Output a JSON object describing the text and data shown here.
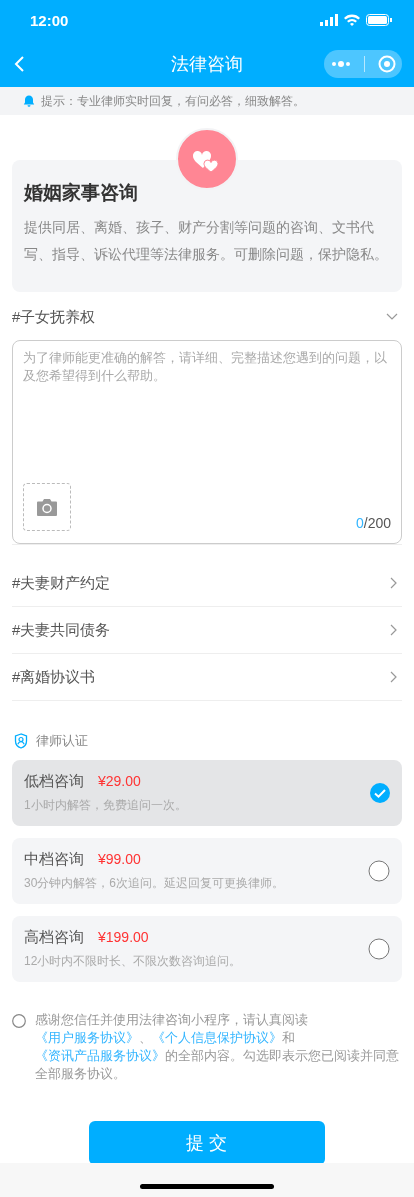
{
  "status_bar": {
    "time": "12:00"
  },
  "nav": {
    "title": "法律咨询"
  },
  "tip": {
    "text": "提示：专业律师实时回复，有问必答，细致解答。"
  },
  "category": {
    "title": "婚姻家事咨询",
    "description": "提供同居、离婚、孩子、财产分割等问题的咨询、文书代写、指导、诉讼代理等法律服务。可删除问题，保护隐私。"
  },
  "topics": [
    {
      "label": "#子女抚养权",
      "expanded": true
    },
    {
      "label": "#夫妻财产约定",
      "expanded": false
    },
    {
      "label": "#夫妻共同债务",
      "expanded": false
    },
    {
      "label": "#离婚协议书",
      "expanded": false
    }
  ],
  "question": {
    "placeholder": "为了律师能更准确的解答，请详细、完整描述您遇到的问题，以及您希望得到什么帮助。",
    "count": "0",
    "limit": "/200"
  },
  "certification": {
    "label": "律师认证"
  },
  "plans": [
    {
      "name": "低档咨询",
      "price": "¥29.00",
      "note": "1小时内解答，免费追问一次。",
      "selected": true
    },
    {
      "name": "中档咨询",
      "price": "¥99.00",
      "note": "30分钟内解答，6次追问。延迟回复可更换律师。",
      "selected": false
    },
    {
      "name": "高档咨询",
      "price": "¥199.00",
      "note": "12小时内不限时长、不限次数咨询追问。",
      "selected": false
    }
  ],
  "agreement": {
    "checked": false,
    "parts": [
      {
        "kind": "text",
        "text": "感谢您信任并使用法律咨询小程序，请认真阅读"
      },
      {
        "kind": "link",
        "text": "《用户服务协议》"
      },
      {
        "kind": "text",
        "text": "、"
      },
      {
        "kind": "link",
        "text": "《个人信息保护协议》"
      },
      {
        "kind": "text",
        "text": "和"
      },
      {
        "kind": "link",
        "text": "《资讯产品服务协议》"
      },
      {
        "kind": "text",
        "text": "的全部内容。勾选即表示您已阅读并同意全部服务协议。"
      }
    ]
  },
  "submit": {
    "label": "提 交"
  }
}
